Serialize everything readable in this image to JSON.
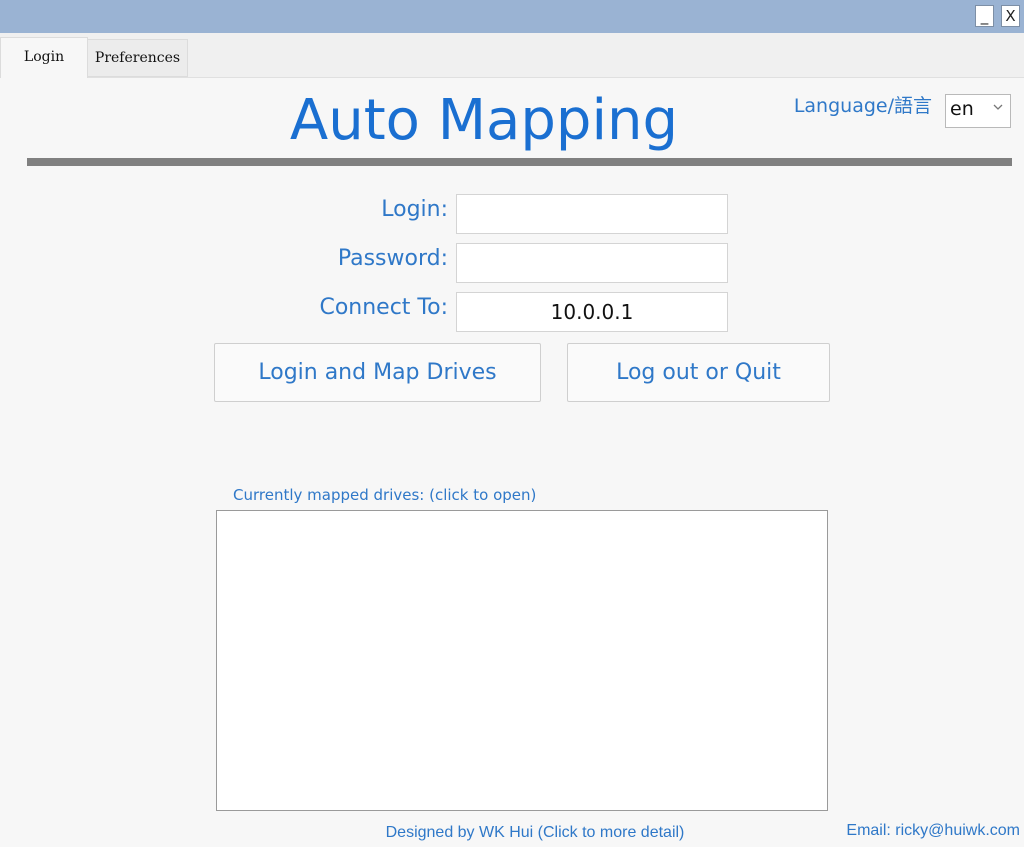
{
  "window": {
    "minimize_label": "_",
    "close_label": "X"
  },
  "tabs": [
    {
      "label": "Login",
      "active": true
    },
    {
      "label": "Preferences",
      "active": false
    }
  ],
  "header": {
    "title": "Auto Mapping",
    "language_label": "Language/語言",
    "language_value": "en",
    "dropdown_icon": "chevron-down-icon"
  },
  "form": {
    "login_label": "Login:",
    "login_value": "",
    "password_label": "Password:",
    "password_value": "",
    "connect_label": "Connect To:",
    "connect_value": "10.0.0.1"
  },
  "actions": {
    "login_button": "Login and Map Drives",
    "logout_button": "Log out or Quit"
  },
  "drives": {
    "caption": "Currently mapped drives: (click to open)",
    "items": []
  },
  "footer": {
    "designed_by": "Designed by WK Hui (Click to more detail)",
    "email": "Email: ricky@huiwk.com"
  },
  "colors": {
    "accent_text": "#2f78c8",
    "title_text": "#1a6fd1",
    "titlebar": "#9ab3d3",
    "divider": "#808080"
  }
}
